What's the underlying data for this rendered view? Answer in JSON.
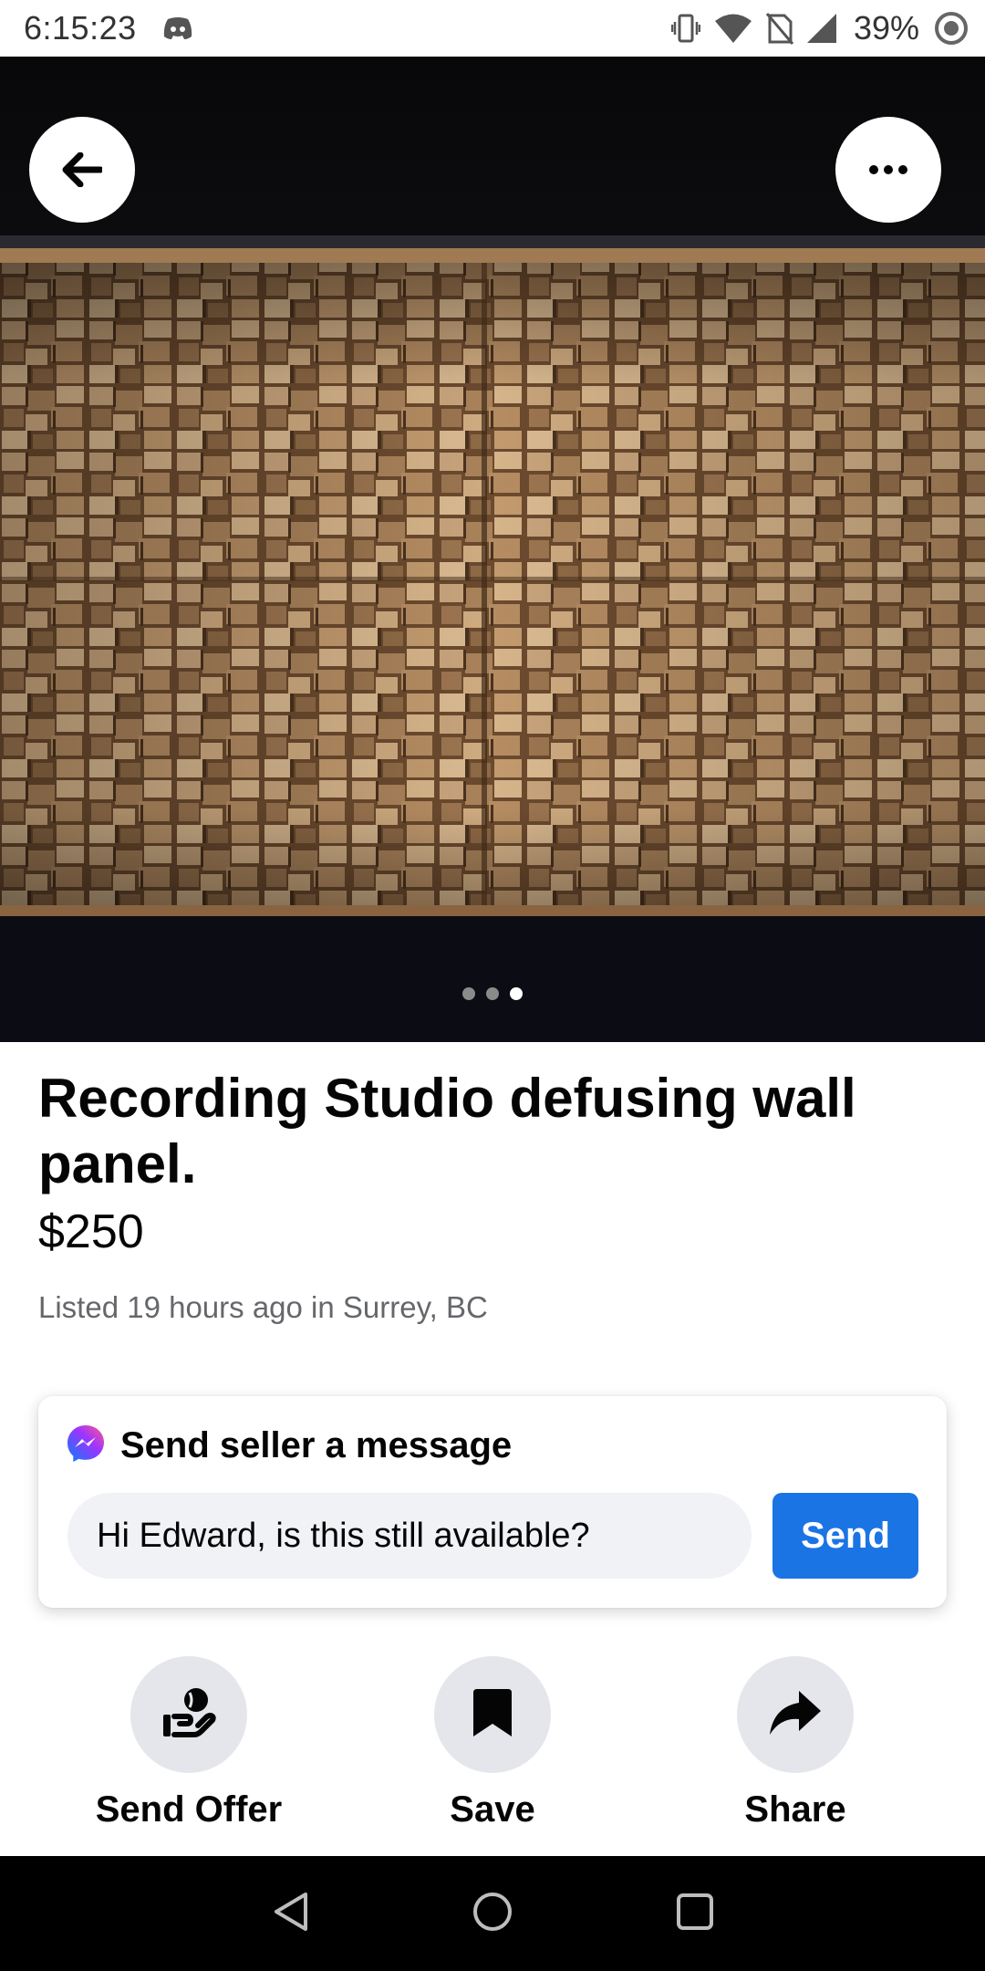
{
  "status_bar": {
    "time": "6:15:23",
    "battery": "39%",
    "icons": [
      "discord-icon",
      "vibrate-icon",
      "wifi-icon",
      "no-sim-icon",
      "signal-icon",
      "battery-icon"
    ]
  },
  "photo": {
    "page_count": 3,
    "active_page": 3
  },
  "listing": {
    "title": "Recording Studio defusing wall panel.",
    "price": "$250",
    "listed": "Listed 19 hours ago in Surrey, BC"
  },
  "message": {
    "header": "Send seller a message",
    "input_value": "Hi Edward, is this still available?",
    "send_label": "Send"
  },
  "actions": {
    "offer_label": "Send Offer",
    "save_label": "Save",
    "share_label": "Share"
  },
  "colors": {
    "accent": "#1b74e4",
    "chip_bg": "#e4e6eb",
    "input_bg": "#f0f2f5",
    "secondary_text": "#65676b"
  }
}
